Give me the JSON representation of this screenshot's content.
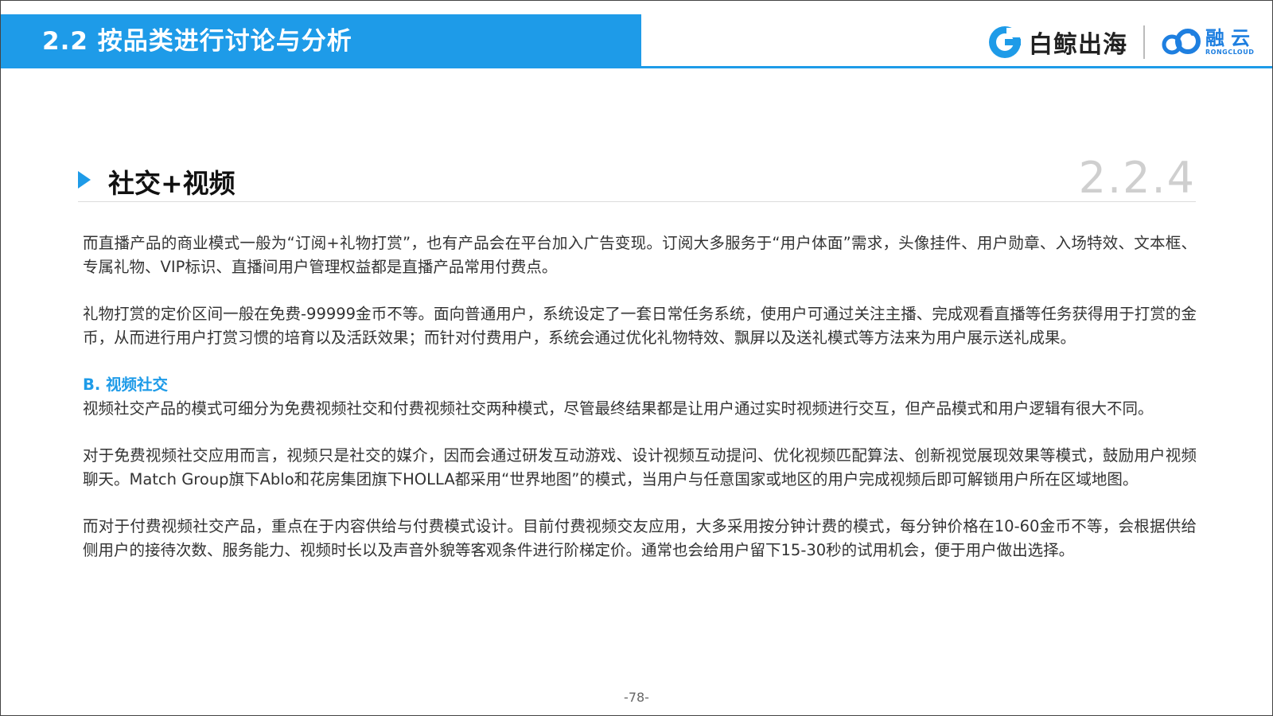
{
  "header": {
    "title": "2.2 按品类进行讨论与分析",
    "logo_baijing": "白鲸出海",
    "logo_rong": "融云",
    "logo_rong_sub": "RONGCLOUD"
  },
  "section": {
    "title": "社交+视频",
    "number": "2.2.4"
  },
  "body": {
    "p1": "而直播产品的商业模式一般为“订阅+礼物打赏”，也有产品会在平台加入广告变现。订阅大多服务于“用户体面”需求，头像挂件、用户勋章、入场特效、文本框、专属礼物、VIP标识、直播间用户管理权益都是直播产品常用付费点。",
    "p2": "礼物打赏的定价区间一般在免费-99999金币不等。面向普通用户，系统设定了一套日常任务系统，使用户可通过关注主播、完成观看直播等任务获得用于打赏的金币，从而进行用户打赏习惯的培育以及活跃效果；而针对付费用户，系统会通过优化礼物特效、飘屏以及送礼模式等方法来为用户展示送礼成果。",
    "subheading": "B. 视频社交",
    "p3": "视频社交产品的模式可细分为免费视频社交和付费视频社交两种模式，尽管最终结果都是让用户通过实时视频进行交互，但产品模式和用户逻辑有很大不同。",
    "p4": "对于免费视频社交应用而言，视频只是社交的媒介，因而会通过研发互动游戏、设计视频互动提问、优化视频匹配算法、创新视觉展现效果等模式，鼓励用户视频聊天。Match Group旗下Ablo和花房集团旗下HOLLA都采用“世界地图”的模式，当用户与任意国家或地区的用户完成视频后即可解锁用户所在区域地图。",
    "p5": "而对于付费视频社交产品，重点在于内容供给与付费模式设计。目前付费视频交友应用，大多采用按分钟计费的模式，每分钟价格在10-60金币不等，会根据供给侧用户的接待次数、服务能力、视频时长以及声音外貌等客观条件进行阶梯定价。通常也会给用户留下15-30秒的试用机会，便于用户做出选择。"
  },
  "footer": {
    "page_number": "-78-"
  },
  "colors": {
    "accent": "#1e9be8",
    "text": "#333333",
    "section_number": "#cfcfcf"
  },
  "icons": [
    "baijing-logo-icon",
    "rongcloud-logo-icon",
    "section-triangle-icon"
  ]
}
